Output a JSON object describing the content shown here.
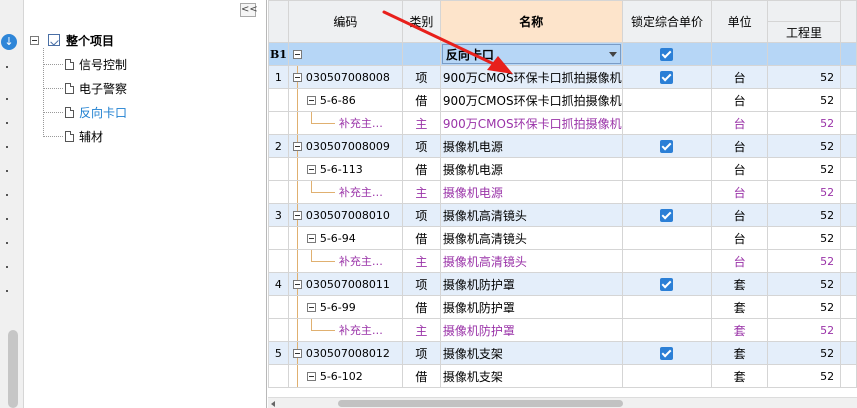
{
  "tree": {
    "collapse_label": "<<",
    "root_label": "整个项目",
    "children": [
      {
        "label": "信号控制"
      },
      {
        "label": "电子警察"
      },
      {
        "label": "反向卡口",
        "selected": true
      },
      {
        "label": "辅材"
      }
    ]
  },
  "grid": {
    "headers": {
      "code": "编码",
      "category": "类别",
      "name": "名称",
      "lock_price": "锁定综合单价",
      "unit": "单位",
      "quantity": "工程里"
    },
    "b1_row": {
      "rownum": "B1",
      "name": "反向卡口",
      "locked": true
    },
    "rows": [
      {
        "type": "parent",
        "rownum": "1",
        "code": "030507008008",
        "category": "项",
        "name": "900万CMOS环保卡口抓拍摄像机",
        "locked": true,
        "unit": "台",
        "quantity": "52"
      },
      {
        "type": "child",
        "rownum": "",
        "code": "5-6-86",
        "category": "借",
        "name": "900万CMOS环保卡口抓拍摄像机",
        "locked": false,
        "unit": "台",
        "quantity": "52"
      },
      {
        "type": "sub",
        "rownum": "",
        "code": "补充主…",
        "category": "主",
        "name": "900万CMOS环保卡口抓拍摄像机",
        "locked": false,
        "unit": "台",
        "quantity": "52"
      },
      {
        "type": "parent",
        "rownum": "2",
        "code": "030507008009",
        "category": "项",
        "name": "摄像机电源",
        "locked": true,
        "unit": "台",
        "quantity": "52"
      },
      {
        "type": "child",
        "rownum": "",
        "code": "5-6-113",
        "category": "借",
        "name": "摄像机电源",
        "locked": false,
        "unit": "台",
        "quantity": "52"
      },
      {
        "type": "sub",
        "rownum": "",
        "code": "补充主…",
        "category": "主",
        "name": "摄像机电源",
        "locked": false,
        "unit": "台",
        "quantity": "52"
      },
      {
        "type": "parent",
        "rownum": "3",
        "code": "030507008010",
        "category": "项",
        "name": "摄像机高清镜头",
        "locked": true,
        "unit": "台",
        "quantity": "52"
      },
      {
        "type": "child",
        "rownum": "",
        "code": "5-6-94",
        "category": "借",
        "name": "摄像机高清镜头",
        "locked": false,
        "unit": "台",
        "quantity": "52"
      },
      {
        "type": "sub",
        "rownum": "",
        "code": "补充主…",
        "category": "主",
        "name": "摄像机高清镜头",
        "locked": false,
        "unit": "台",
        "quantity": "52"
      },
      {
        "type": "parent",
        "rownum": "4",
        "code": "030507008011",
        "category": "项",
        "name": "摄像机防护罩",
        "locked": true,
        "unit": "套",
        "quantity": "52"
      },
      {
        "type": "child",
        "rownum": "",
        "code": "5-6-99",
        "category": "借",
        "name": "摄像机防护罩",
        "locked": false,
        "unit": "套",
        "quantity": "52"
      },
      {
        "type": "sub",
        "rownum": "",
        "code": "补充主…",
        "category": "主",
        "name": "摄像机防护罩",
        "locked": false,
        "unit": "套",
        "quantity": "52"
      },
      {
        "type": "parent",
        "rownum": "5",
        "code": "030507008012",
        "category": "项",
        "name": "摄像机支架",
        "locked": true,
        "unit": "套",
        "quantity": "52"
      },
      {
        "type": "child",
        "rownum": "",
        "code": "5-6-102",
        "category": "借",
        "name": "摄像机支架",
        "locked": false,
        "unit": "套",
        "quantity": "52"
      }
    ]
  },
  "colors": {
    "accent": "#2b7fd6",
    "b1_row": "#b6d6f6",
    "parent_row": "#e4eefa",
    "sub_text": "#9a33a8",
    "arrow": "#e8201c"
  }
}
